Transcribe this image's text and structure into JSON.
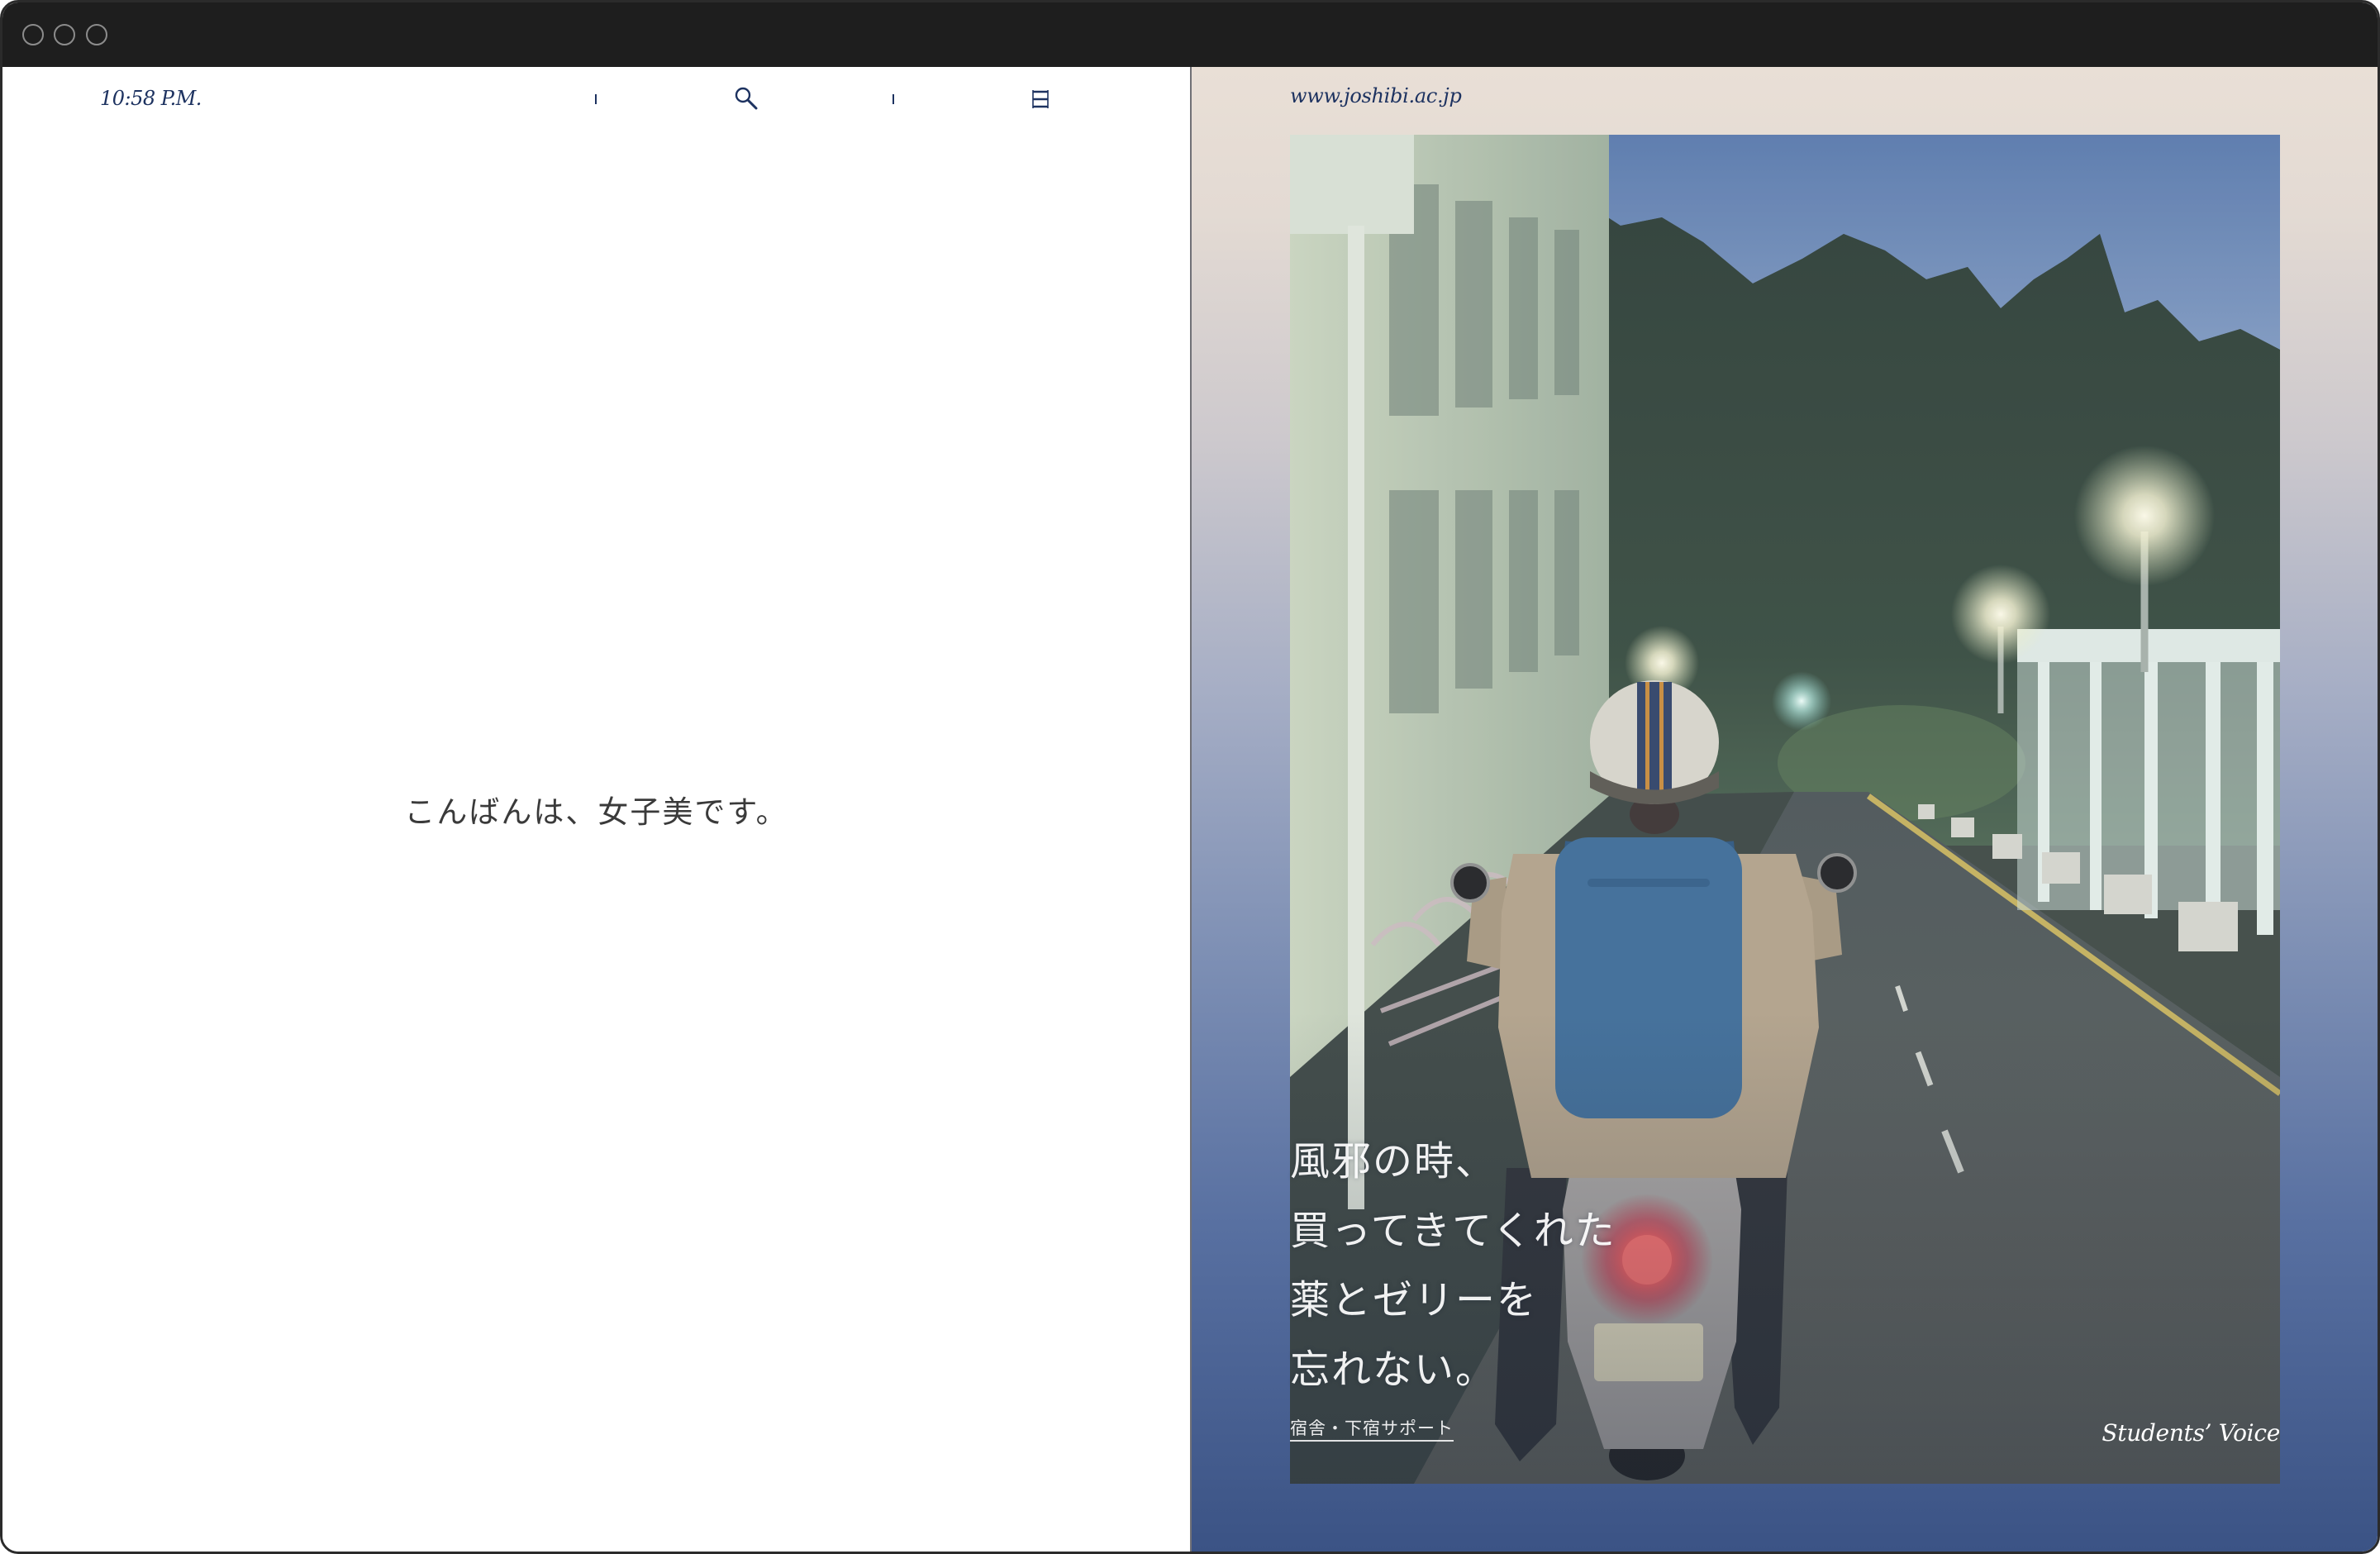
{
  "left_panel": {
    "time": "10:58 P.M.",
    "greeting": "こんばんは、女子美です。",
    "icons": {
      "search": "search-icon",
      "menu": "menu-icon"
    }
  },
  "right_panel": {
    "url": "www.joshibi.ac.jp",
    "feature": {
      "headline": [
        "風邪の時、",
        "買ってきてくれた",
        "薬とゼリーを",
        "忘れない。"
      ],
      "link": "宿舎・下宿サポート",
      "category": "Students’ Voice"
    }
  },
  "colors": {
    "navy_text": "#1d3260",
    "titlebar": "#1e1e1e",
    "gradient_top": "#e9dfd6",
    "gradient_bottom": "#3b5385",
    "headline_text": "#ffffff"
  }
}
